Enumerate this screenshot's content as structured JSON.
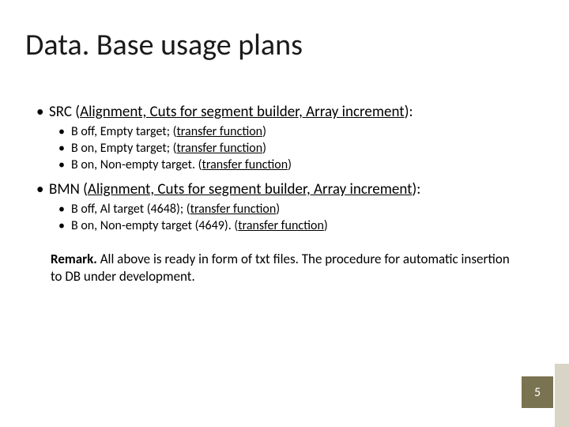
{
  "title": "Data. Base usage plans",
  "sections": [
    {
      "label_prefix": "SRC (",
      "label_underlined": "Alignment, Cuts for segment builder, Array increment",
      "label_suffix": "):",
      "items": [
        {
          "text": "B off, Empty target;  (",
          "ul": "transfer function",
          "tail": ")"
        },
        {
          "text": "B on, Empty target; (",
          "ul": "transfer function",
          "tail": ")"
        },
        {
          "text": "B on, Non-empty target. (",
          "ul": "transfer function",
          "tail": ")"
        }
      ]
    },
    {
      "label_prefix": "BMN (",
      "label_underlined": "Alignment, Cuts for segment builder, Array increment",
      "label_suffix": "):",
      "items": [
        {
          "text": "B off, Al target (4648); (",
          "ul": "transfer function",
          "tail": ")"
        },
        {
          "text": "B on, Non-empty target (4649). (",
          "ul": "transfer function",
          "tail": ")"
        }
      ]
    }
  ],
  "remark_label": "Remark.",
  "remark_text": " All above is ready in form of txt files. The procedure for automatic insertion to DB under development.",
  "page_number": "5"
}
